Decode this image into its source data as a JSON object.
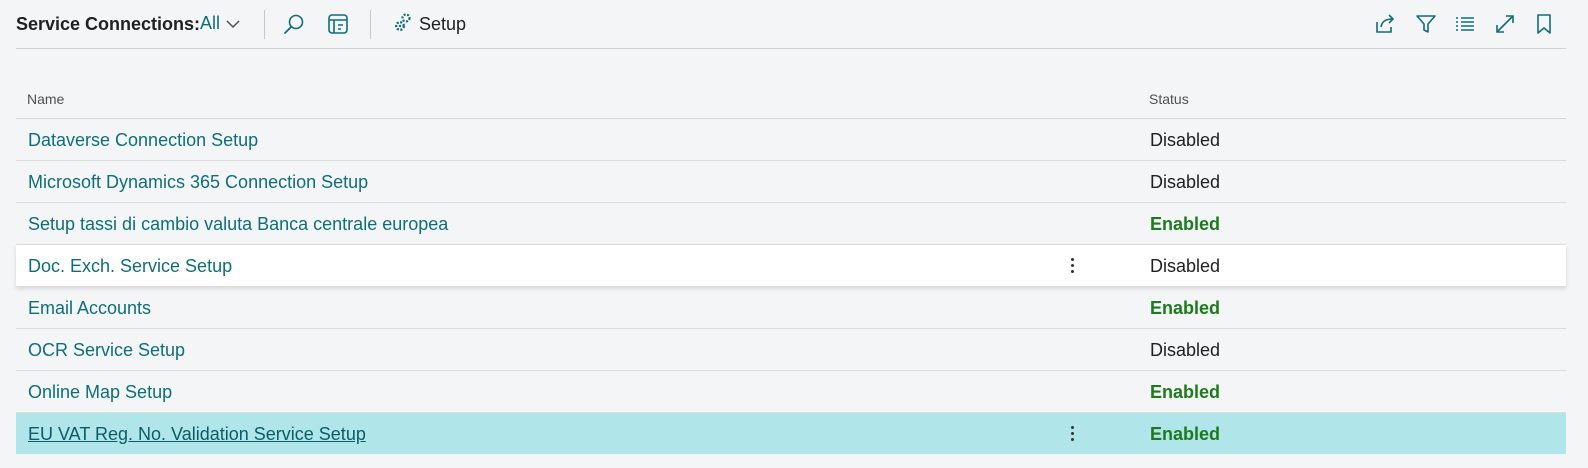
{
  "toolbar": {
    "title": "Service Connections:",
    "view_label": "All",
    "setup_label": "Setup"
  },
  "grid": {
    "columns": {
      "name": "Name",
      "status": "Status"
    },
    "rows": [
      {
        "name": "Dataverse Connection Setup",
        "status": "Disabled"
      },
      {
        "name": "Microsoft Dynamics 365 Connection Setup",
        "status": "Disabled"
      },
      {
        "name": "Setup tassi di cambio valuta Banca centrale europea",
        "status": "Enabled"
      },
      {
        "name": "Doc. Exch. Service Setup",
        "status": "Disabled"
      },
      {
        "name": "Email Accounts",
        "status": "Enabled"
      },
      {
        "name": "OCR Service Setup",
        "status": "Disabled"
      },
      {
        "name": "Online Map Setup",
        "status": "Enabled"
      },
      {
        "name": "EU VAT Reg. No. Validation Service Setup",
        "status": "Enabled"
      }
    ]
  },
  "colors": {
    "link": "#0e6e7a",
    "enabled": "#1d7a1d",
    "selected_row": "#b0e6e9",
    "background": "#f4f5f6"
  },
  "icons": [
    "chevron-down-icon",
    "search-icon",
    "edit-list-icon",
    "setup-gear-icon",
    "share-icon",
    "filter-icon",
    "list-view-icon",
    "expand-icon",
    "bookmark-icon",
    "more-options-icon"
  ]
}
